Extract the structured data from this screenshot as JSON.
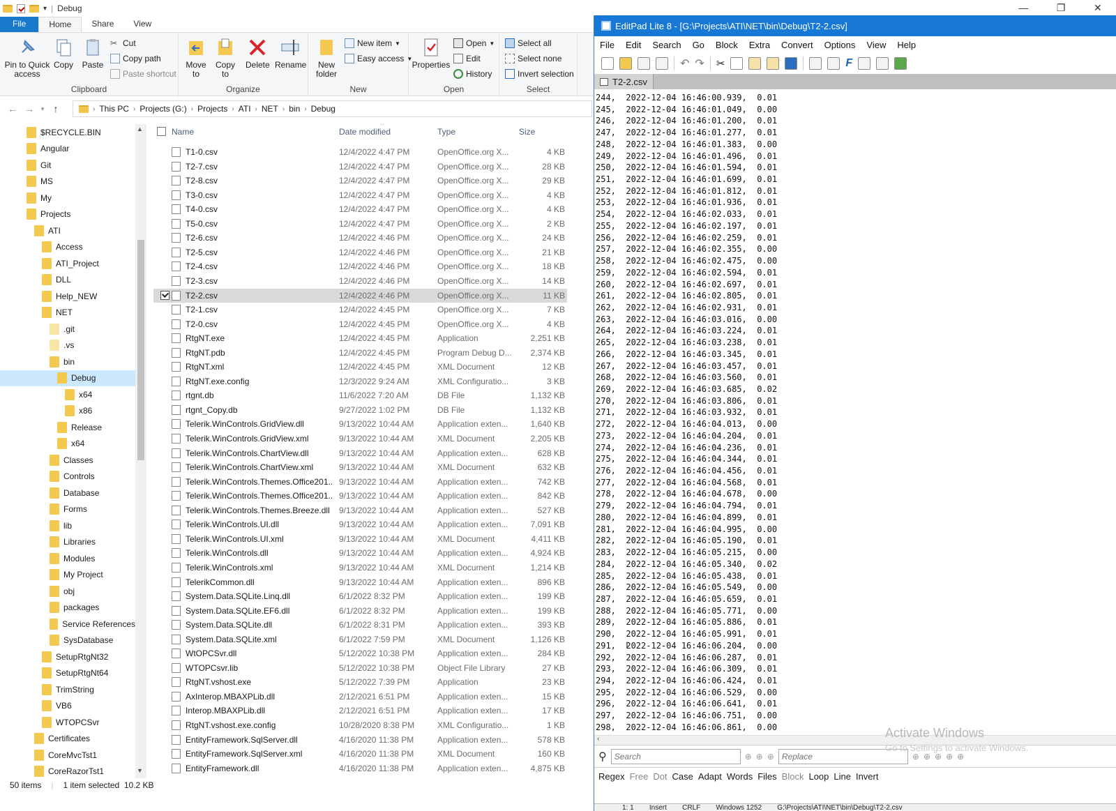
{
  "explorer": {
    "title": "Debug",
    "tabs": [
      "File",
      "Home",
      "Share",
      "View"
    ],
    "ribbon": {
      "clipboard": {
        "group": "Clipboard",
        "pin": "Pin to Quick access",
        "copy": "Copy",
        "paste": "Paste",
        "cut": "Cut",
        "copy_path": "Copy path",
        "paste_shortcut": "Paste shortcut"
      },
      "organize": {
        "group": "Organize",
        "move_to": "Move to",
        "copy_to": "Copy to",
        "delete": "Delete",
        "rename": "Rename"
      },
      "new": {
        "group": "New",
        "new_folder": "New folder",
        "new_item": "New item",
        "easy_access": "Easy access"
      },
      "open": {
        "group": "Open",
        "properties": "Properties",
        "open": "Open",
        "edit": "Edit",
        "history": "History"
      },
      "select": {
        "group": "Select",
        "select_all": "Select all",
        "select_none": "Select none",
        "invert": "Invert selection"
      }
    },
    "breadcrumb": [
      "This PC",
      "Projects (G:)",
      "Projects",
      "ATI",
      "NET",
      "bin",
      "Debug"
    ],
    "nav_items": [
      {
        "label": "$RECYCLE.BIN",
        "indent": 0,
        "pale": false
      },
      {
        "label": "Angular",
        "indent": 0,
        "pale": false
      },
      {
        "label": "Git",
        "indent": 0,
        "pale": false
      },
      {
        "label": "MS",
        "indent": 0,
        "pale": false
      },
      {
        "label": "My",
        "indent": 0,
        "pale": false
      },
      {
        "label": "Projects",
        "indent": 0,
        "pale": false
      },
      {
        "label": "ATI",
        "indent": 1,
        "pale": false
      },
      {
        "label": "Access",
        "indent": 2,
        "pale": false
      },
      {
        "label": "ATI_Project",
        "indent": 2,
        "pale": false
      },
      {
        "label": "DLL",
        "indent": 2,
        "pale": false
      },
      {
        "label": "Help_NEW",
        "indent": 2,
        "pale": false
      },
      {
        "label": "NET",
        "indent": 2,
        "pale": false
      },
      {
        "label": ".git",
        "indent": 3,
        "pale": true
      },
      {
        "label": ".vs",
        "indent": 3,
        "pale": true
      },
      {
        "label": "bin",
        "indent": 3,
        "pale": false
      },
      {
        "label": "Debug",
        "indent": 4,
        "pale": false,
        "selected": true
      },
      {
        "label": "x64",
        "indent": 5,
        "pale": false
      },
      {
        "label": "x86",
        "indent": 5,
        "pale": false
      },
      {
        "label": "Release",
        "indent": 4,
        "pale": false
      },
      {
        "label": "x64",
        "indent": 4,
        "pale": false
      },
      {
        "label": "Classes",
        "indent": 3,
        "pale": false
      },
      {
        "label": "Controls",
        "indent": 3,
        "pale": false
      },
      {
        "label": "Database",
        "indent": 3,
        "pale": false
      },
      {
        "label": "Forms",
        "indent": 3,
        "pale": false
      },
      {
        "label": "lib",
        "indent": 3,
        "pale": false
      },
      {
        "label": "Libraries",
        "indent": 3,
        "pale": false
      },
      {
        "label": "Modules",
        "indent": 3,
        "pale": false
      },
      {
        "label": "My Project",
        "indent": 3,
        "pale": false
      },
      {
        "label": "obj",
        "indent": 3,
        "pale": false
      },
      {
        "label": "packages",
        "indent": 3,
        "pale": false
      },
      {
        "label": "Service References",
        "indent": 3,
        "pale": false
      },
      {
        "label": "SysDatabase",
        "indent": 3,
        "pale": false
      },
      {
        "label": "SetupRtgNt32",
        "indent": 2,
        "pale": false
      },
      {
        "label": "SetupRtgNt64",
        "indent": 2,
        "pale": false
      },
      {
        "label": "TrimString",
        "indent": 2,
        "pale": false
      },
      {
        "label": "VB6",
        "indent": 2,
        "pale": false
      },
      {
        "label": "WTOPCSvr",
        "indent": 2,
        "pale": false
      },
      {
        "label": "Certificates",
        "indent": 1,
        "pale": false
      },
      {
        "label": "CoreMvcTst1",
        "indent": 1,
        "pale": false
      },
      {
        "label": "CoreRazorTst1",
        "indent": 1,
        "pale": false
      }
    ],
    "columns": {
      "name": "Name",
      "date": "Date modified",
      "type": "Type",
      "size": "Size"
    },
    "files": [
      {
        "name": "T1-0.csv",
        "date": "12/4/2022 4:47 PM",
        "type": "OpenOffice.org X...",
        "size": "4 KB"
      },
      {
        "name": "T2-7.csv",
        "date": "12/4/2022 4:47 PM",
        "type": "OpenOffice.org X...",
        "size": "28 KB"
      },
      {
        "name": "T2-8.csv",
        "date": "12/4/2022 4:47 PM",
        "type": "OpenOffice.org X...",
        "size": "29 KB"
      },
      {
        "name": "T3-0.csv",
        "date": "12/4/2022 4:47 PM",
        "type": "OpenOffice.org X...",
        "size": "4 KB"
      },
      {
        "name": "T4-0.csv",
        "date": "12/4/2022 4:47 PM",
        "type": "OpenOffice.org X...",
        "size": "4 KB"
      },
      {
        "name": "T5-0.csv",
        "date": "12/4/2022 4:47 PM",
        "type": "OpenOffice.org X...",
        "size": "2 KB"
      },
      {
        "name": "T2-6.csv",
        "date": "12/4/2022 4:46 PM",
        "type": "OpenOffice.org X...",
        "size": "24 KB"
      },
      {
        "name": "T2-5.csv",
        "date": "12/4/2022 4:46 PM",
        "type": "OpenOffice.org X...",
        "size": "21 KB"
      },
      {
        "name": "T2-4.csv",
        "date": "12/4/2022 4:46 PM",
        "type": "OpenOffice.org X...",
        "size": "18 KB"
      },
      {
        "name": "T2-3.csv",
        "date": "12/4/2022 4:46 PM",
        "type": "OpenOffice.org X...",
        "size": "14 KB"
      },
      {
        "name": "T2-2.csv",
        "date": "12/4/2022 4:46 PM",
        "type": "OpenOffice.org X...",
        "size": "11 KB",
        "selected": true
      },
      {
        "name": "T2-1.csv",
        "date": "12/4/2022 4:45 PM",
        "type": "OpenOffice.org X...",
        "size": "7 KB"
      },
      {
        "name": "T2-0.csv",
        "date": "12/4/2022 4:45 PM",
        "type": "OpenOffice.org X...",
        "size": "4 KB"
      },
      {
        "name": "RtgNT.exe",
        "date": "12/4/2022 4:45 PM",
        "type": "Application",
        "size": "2,251 KB"
      },
      {
        "name": "RtgNT.pdb",
        "date": "12/4/2022 4:45 PM",
        "type": "Program Debug D...",
        "size": "2,374 KB"
      },
      {
        "name": "RtgNT.xml",
        "date": "12/4/2022 4:45 PM",
        "type": "XML Document",
        "size": "12 KB"
      },
      {
        "name": "RtgNT.exe.config",
        "date": "12/3/2022 9:24 AM",
        "type": "XML Configuratio...",
        "size": "3 KB"
      },
      {
        "name": "rtgnt.db",
        "date": "11/6/2022 7:20 AM",
        "type": "DB File",
        "size": "1,132 KB"
      },
      {
        "name": "rtgnt_Copy.db",
        "date": "9/27/2022 1:02 PM",
        "type": "DB File",
        "size": "1,132 KB"
      },
      {
        "name": "Telerik.WinControls.GridView.dll",
        "date": "9/13/2022 10:44 AM",
        "type": "Application exten...",
        "size": "1,640 KB"
      },
      {
        "name": "Telerik.WinControls.GridView.xml",
        "date": "9/13/2022 10:44 AM",
        "type": "XML Document",
        "size": "2,205 KB"
      },
      {
        "name": "Telerik.WinControls.ChartView.dll",
        "date": "9/13/2022 10:44 AM",
        "type": "Application exten...",
        "size": "628 KB"
      },
      {
        "name": "Telerik.WinControls.ChartView.xml",
        "date": "9/13/2022 10:44 AM",
        "type": "XML Document",
        "size": "632 KB"
      },
      {
        "name": "Telerik.WinControls.Themes.Office201...",
        "date": "9/13/2022 10:44 AM",
        "type": "Application exten...",
        "size": "742 KB"
      },
      {
        "name": "Telerik.WinControls.Themes.Office201...",
        "date": "9/13/2022 10:44 AM",
        "type": "Application exten...",
        "size": "842 KB"
      },
      {
        "name": "Telerik.WinControls.Themes.Breeze.dll",
        "date": "9/13/2022 10:44 AM",
        "type": "Application exten...",
        "size": "527 KB"
      },
      {
        "name": "Telerik.WinControls.UI.dll",
        "date": "9/13/2022 10:44 AM",
        "type": "Application exten...",
        "size": "7,091 KB"
      },
      {
        "name": "Telerik.WinControls.UI.xml",
        "date": "9/13/2022 10:44 AM",
        "type": "XML Document",
        "size": "4,411 KB"
      },
      {
        "name": "Telerik.WinControls.dll",
        "date": "9/13/2022 10:44 AM",
        "type": "Application exten...",
        "size": "4,924 KB"
      },
      {
        "name": "Telerik.WinControls.xml",
        "date": "9/13/2022 10:44 AM",
        "type": "XML Document",
        "size": "1,214 KB"
      },
      {
        "name": "TelerikCommon.dll",
        "date": "9/13/2022 10:44 AM",
        "type": "Application exten...",
        "size": "896 KB"
      },
      {
        "name": "System.Data.SQLite.Linq.dll",
        "date": "6/1/2022 8:32 PM",
        "type": "Application exten...",
        "size": "199 KB"
      },
      {
        "name": "System.Data.SQLite.EF6.dll",
        "date": "6/1/2022 8:32 PM",
        "type": "Application exten...",
        "size": "199 KB"
      },
      {
        "name": "System.Data.SQLite.dll",
        "date": "6/1/2022 8:31 PM",
        "type": "Application exten...",
        "size": "393 KB"
      },
      {
        "name": "System.Data.SQLite.xml",
        "date": "6/1/2022 7:59 PM",
        "type": "XML Document",
        "size": "1,126 KB"
      },
      {
        "name": "WtOPCSvr.dll",
        "date": "5/12/2022 10:38 PM",
        "type": "Application exten...",
        "size": "284 KB"
      },
      {
        "name": "WTOPCsvr.lib",
        "date": "5/12/2022 10:38 PM",
        "type": "Object File Library",
        "size": "27 KB"
      },
      {
        "name": "RtgNT.vshost.exe",
        "date": "5/12/2022 7:39 PM",
        "type": "Application",
        "size": "23 KB"
      },
      {
        "name": "AxInterop.MBAXPLib.dll",
        "date": "2/12/2021 6:51 PM",
        "type": "Application exten...",
        "size": "15 KB"
      },
      {
        "name": "Interop.MBAXPLib.dll",
        "date": "2/12/2021 6:51 PM",
        "type": "Application exten...",
        "size": "17 KB"
      },
      {
        "name": "RtgNT.vshost.exe.config",
        "date": "10/28/2020 8:38 PM",
        "type": "XML Configuratio...",
        "size": "1 KB"
      },
      {
        "name": "EntityFramework.SqlServer.dll",
        "date": "4/16/2020 11:38 PM",
        "type": "Application exten...",
        "size": "578 KB"
      },
      {
        "name": "EntityFramework.SqlServer.xml",
        "date": "4/16/2020 11:38 PM",
        "type": "XML Document",
        "size": "160 KB"
      },
      {
        "name": "EntityFramework.dll",
        "date": "4/16/2020 11:38 PM",
        "type": "Application exten...",
        "size": "4,875 KB"
      }
    ],
    "status": {
      "items": "50 items",
      "selected": "1 item selected  10.2 KB"
    }
  },
  "editpad": {
    "title": "EditPad Lite 8 - [G:\\Projects\\ATI\\NET\\bin\\Debug\\T2-2.csv]",
    "menu": [
      "File",
      "Edit",
      "Search",
      "Go",
      "Block",
      "Extra",
      "Convert",
      "Options",
      "View",
      "Help"
    ],
    "tab": "T2-2.csv",
    "lines": [
      "244,  2022-12-04 16:46:00.939,  0.01",
      "245,  2022-12-04 16:46:01.049,  0.00",
      "246,  2022-12-04 16:46:01.200,  0.01",
      "247,  2022-12-04 16:46:01.277,  0.01",
      "248,  2022-12-04 16:46:01.383,  0.00",
      "249,  2022-12-04 16:46:01.496,  0.01",
      "250,  2022-12-04 16:46:01.594,  0.01",
      "251,  2022-12-04 16:46:01.699,  0.01",
      "252,  2022-12-04 16:46:01.812,  0.01",
      "253,  2022-12-04 16:46:01.936,  0.01",
      "254,  2022-12-04 16:46:02.033,  0.01",
      "255,  2022-12-04 16:46:02.197,  0.01",
      "256,  2022-12-04 16:46:02.259,  0.01",
      "257,  2022-12-04 16:46:02.355,  0.00",
      "258,  2022-12-04 16:46:02.475,  0.00",
      "259,  2022-12-04 16:46:02.594,  0.01",
      "260,  2022-12-04 16:46:02.697,  0.01",
      "261,  2022-12-04 16:46:02.805,  0.01",
      "262,  2022-12-04 16:46:02.931,  0.01",
      "263,  2022-12-04 16:46:03.016,  0.00",
      "264,  2022-12-04 16:46:03.224,  0.01",
      "265,  2022-12-04 16:46:03.238,  0.01",
      "266,  2022-12-04 16:46:03.345,  0.01",
      "267,  2022-12-04 16:46:03.457,  0.01",
      "268,  2022-12-04 16:46:03.560,  0.01",
      "269,  2022-12-04 16:46:03.685,  0.02",
      "270,  2022-12-04 16:46:03.806,  0.01",
      "271,  2022-12-04 16:46:03.932,  0.01",
      "272,  2022-12-04 16:46:04.013,  0.00",
      "273,  2022-12-04 16:46:04.204,  0.01",
      "274,  2022-12-04 16:46:04.236,  0.01",
      "275,  2022-12-04 16:46:04.344,  0.01",
      "276,  2022-12-04 16:46:04.456,  0.01",
      "277,  2022-12-04 16:46:04.568,  0.01",
      "278,  2022-12-04 16:46:04.678,  0.00",
      "279,  2022-12-04 16:46:04.794,  0.01",
      "280,  2022-12-04 16:46:04.899,  0.01",
      "281,  2022-12-04 16:46:04.995,  0.00",
      "282,  2022-12-04 16:46:05.190,  0.01",
      "283,  2022-12-04 16:46:05.215,  0.00",
      "284,  2022-12-04 16:46:05.340,  0.02",
      "285,  2022-12-04 16:46:05.438,  0.01",
      "286,  2022-12-04 16:46:05.549,  0.00",
      "287,  2022-12-04 16:46:05.659,  0.01",
      "288,  2022-12-04 16:46:05.771,  0.00",
      "289,  2022-12-04 16:46:05.886,  0.01",
      "290,  2022-12-04 16:46:05.991,  0.01",
      "291,  2022-12-04 16:46:06.204,  0.00",
      "292,  2022-12-04 16:46:06.287,  0.01",
      "293,  2022-12-04 16:46:06.309,  0.01",
      "294,  2022-12-04 16:46:06.424,  0.01",
      "295,  2022-12-04 16:46:06.529,  0.00",
      "296,  2022-12-04 16:46:06.641,  0.01",
      "297,  2022-12-04 16:46:06.751,  0.00",
      "298,  2022-12-04 16:46:06.861,  0.00"
    ],
    "search_placeholder": "Search",
    "replace_placeholder": "Replace",
    "options": [
      "Regex",
      "Free",
      "Dot",
      "Case",
      "Adapt",
      "Words",
      "Files",
      "Block",
      "Loop",
      "Line",
      "Invert"
    ],
    "disabled_options": [
      "Free",
      "Dot",
      "Block"
    ],
    "status": "1: 1        Insert        CRLF        Windows 1252        G:\\Projects\\ATI\\NET\\bin\\Debug\\T2-2.csv"
  },
  "watermark": {
    "title": "Activate Windows",
    "sub": "Go to Settings to activate Windows."
  },
  "colors": {
    "accent": "#1979ca",
    "editpad_title": "#1878d6",
    "selected_row": "#d9d9d9",
    "nav_selected": "#cce8ff"
  }
}
